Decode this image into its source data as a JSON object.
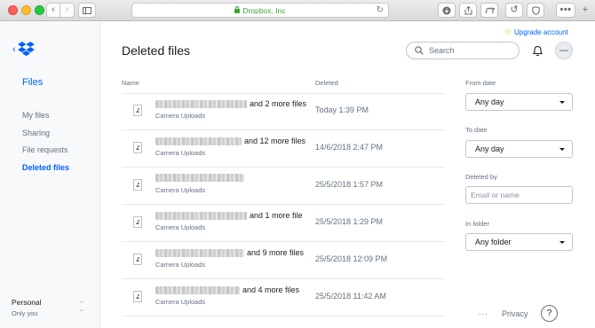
{
  "browser": {
    "url_text": "Dropbox, Inc"
  },
  "sidebar": {
    "heading": "Files",
    "items": [
      {
        "label": "My files"
      },
      {
        "label": "Sharing"
      },
      {
        "label": "File requests"
      },
      {
        "label": "Deleted files",
        "active": true
      }
    ],
    "account": {
      "name": "Personal",
      "sub": "Only you"
    }
  },
  "header": {
    "upgrade_label": "Upgrade account",
    "title": "Deleted files",
    "search_placeholder": "Search"
  },
  "table": {
    "col_name": "Name",
    "col_deleted": "Deleted",
    "rows": [
      {
        "suffix": "and 2 more files",
        "location": "Camera Uploads",
        "deleted": "Today 1:39 PM"
      },
      {
        "suffix": "and 12 more files",
        "location": "Camera Uploads",
        "deleted": "14/6/2018 2:47 PM"
      },
      {
        "suffix": "",
        "location": "Camera Uploads",
        "deleted": "25/5/2018 1:57 PM"
      },
      {
        "suffix": "and 1 more file",
        "location": "Camera Uploads",
        "deleted": "25/5/2018 1:29 PM"
      },
      {
        "suffix": "and 9 more files",
        "location": "Camera Uploads",
        "deleted": "25/5/2018 12:09 PM"
      },
      {
        "suffix": "and 4 more files",
        "location": "Camera Uploads",
        "deleted": "25/5/2018 11:42 AM"
      }
    ]
  },
  "filters": {
    "from_label": "From date",
    "from_value": "Any day",
    "to_label": "To date",
    "to_value": "Any day",
    "deleted_by_label": "Deleted by",
    "deleted_by_placeholder": "Email or name",
    "folder_label": "In folder",
    "folder_value": "Any folder"
  },
  "footer": {
    "more": "...",
    "privacy": "Privacy",
    "help": "?"
  },
  "colors": {
    "accent": "#0061fe",
    "muted": "#637282",
    "url_green": "#3fa33a"
  }
}
